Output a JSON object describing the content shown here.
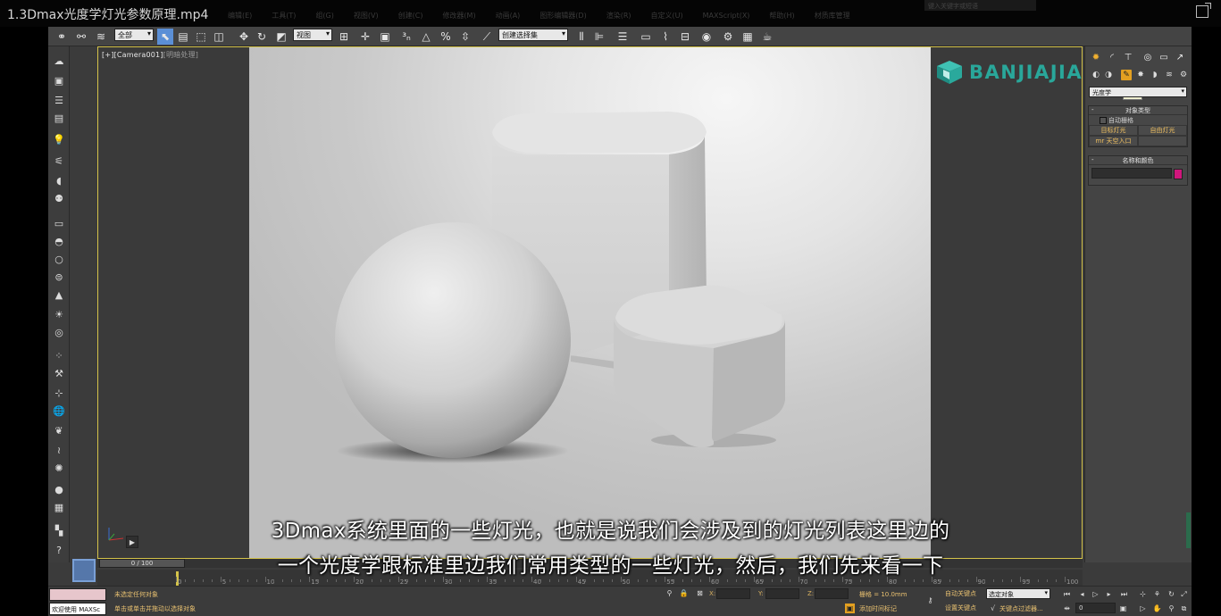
{
  "video": {
    "title": "1.3Dmax光度学灯光参数原理.mp4"
  },
  "menubar_ghost": [
    "编辑(E)",
    "工具(T)",
    "组(G)",
    "视图(V)",
    "创建(C)",
    "修改器(M)",
    "动画(A)",
    "图形编辑器(D)",
    "渲染(R)",
    "自定义(U)",
    "MAXScript(X)",
    "帮助(H)",
    "材质库管理"
  ],
  "search_ghost": "键入关键字或短语",
  "toolbar": {
    "selection_filter": "全部",
    "reference_coord": "视图",
    "named_selection": "创建选择集"
  },
  "viewport": {
    "label_main": "[+][Camera001]",
    "label_sub": "[明暗处理]"
  },
  "logo": {
    "text": "BANJIAJIA",
    "color": "#29a79a"
  },
  "command_panel": {
    "tooltip": "灯光",
    "category": "光度学",
    "object_type_title": "对象类型",
    "auto_grid": "自动栅格",
    "buttons": [
      "目标灯光",
      "自由灯光",
      "mr 天空入口"
    ],
    "name_color_title": "名称和颜色",
    "color": "#d0167c"
  },
  "subtitles": {
    "line1": "3Dmax系统里面的一些灯光，也就是说我们会涉及到的灯光列表这里边的",
    "line2": "一个光度学跟标准里边我们常用类型的一些灯光，然后，我们先来看一下"
  },
  "timeline": {
    "frame_display": "0 / 100",
    "ticks": [
      "0",
      "5",
      "10",
      "15",
      "20",
      "25",
      "30",
      "35",
      "40",
      "45",
      "50",
      "55",
      "60",
      "65",
      "70",
      "75",
      "80",
      "85",
      "90",
      "95",
      "100"
    ]
  },
  "status_bar": {
    "welcome": "欢迎使用 MAXSc",
    "message1": "未选定任何对象",
    "message2": "单击或单击并拖动以选择对象",
    "x_label": "X:",
    "y_label": "Y:",
    "z_label": "Z:",
    "grid": "栅格 = 10.0mm",
    "add_time_tag": "添加时间标记",
    "auto_key": "自动关键点",
    "set_key": "设置关键点",
    "key_mode": "选定对象",
    "key_filters": "关键点过滤器...",
    "frame": "0"
  }
}
